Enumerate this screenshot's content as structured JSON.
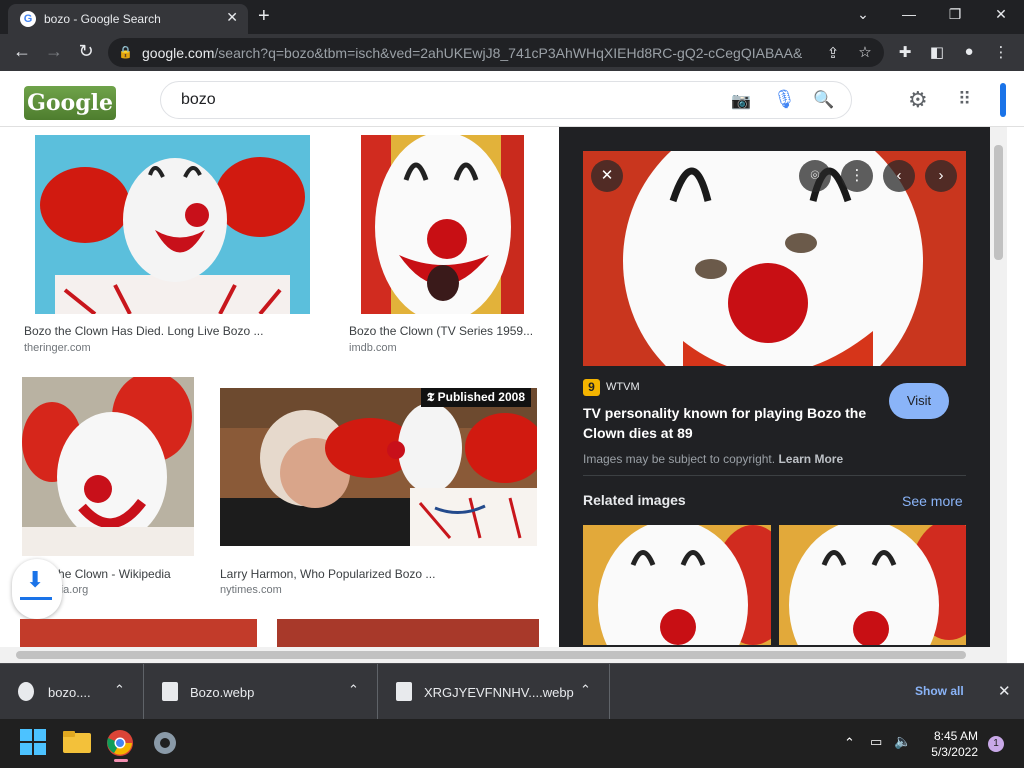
{
  "browser": {
    "tab_title": "bozo - Google Search",
    "url_domain": "google.com",
    "url_path": "/search?q=bozo&tbm=isch&ved=2ahUKEwjJ8_741cP3AhWHqXIEHd8RC-gQ2-cCegQIABAA&o..."
  },
  "google": {
    "logo_text": "Google",
    "query": "bozo"
  },
  "results": [
    {
      "caption": "Bozo the Clown Has Died. Long Live Bozo ...",
      "source": "theringer.com"
    },
    {
      "caption": "Bozo the Clown (TV Series 1959...",
      "source": "imdb.com"
    },
    {
      "caption": "Bozo the Clown - Wikipedia",
      "source": "wikipedia.org"
    },
    {
      "caption": "Larry Harmon, Who Popularized Bozo ...",
      "source": "nytimes.com",
      "badge": "Published 2008"
    }
  ],
  "panel": {
    "source_badge": "9",
    "source_name": "WTVM",
    "title": "TV personality known for playing Bozo the Clown dies at 89",
    "visit_label": "Visit",
    "copyright_text": "Images may be subject to copyright.",
    "learn_more": "Learn More",
    "related_label": "Related images",
    "see_more": "See more"
  },
  "downloads": {
    "items": [
      {
        "name": "bozo...."
      },
      {
        "name": "Bozo.webp"
      },
      {
        "name": "XRGJYEVFNNHV....webp"
      }
    ],
    "show_all": "Show all"
  },
  "taskbar": {
    "time": "8:45 AM",
    "date": "5/3/2022",
    "notifications": "1"
  }
}
